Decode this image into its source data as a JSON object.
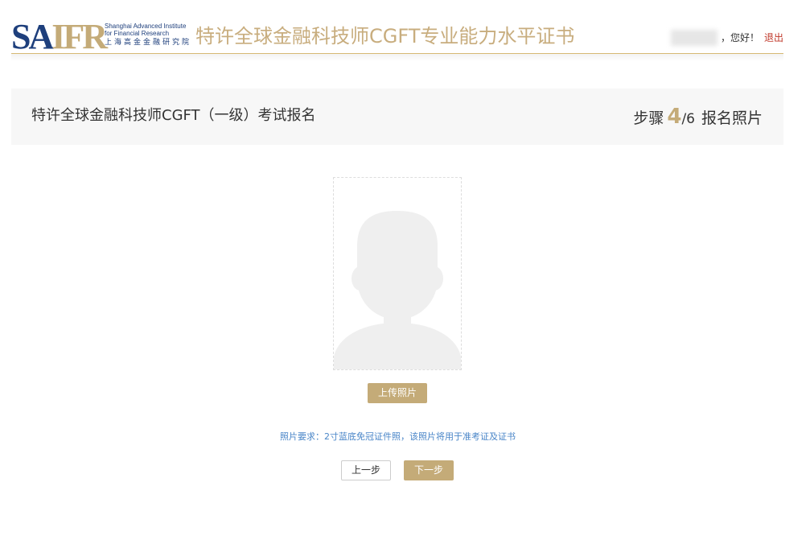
{
  "header": {
    "logo": {
      "mark": "SAIFR",
      "en_line1": "Shanghai Advanced Institute",
      "en_line2": "for Financial Research",
      "cn": "上海高金金融研究院"
    },
    "site_title": "特许全球金融科技师CGFT专业能力水平证书",
    "user": {
      "greeting": "，您好！",
      "logout_label": "退出"
    }
  },
  "title_bar": {
    "exam_title": "特许全球金融科技师CGFT（一级）考试报名",
    "step_prefix": "步骤",
    "step_current": "4",
    "step_total": "/6",
    "step_name": "报名照片"
  },
  "photo": {
    "placeholder_icon": "person-silhouette-icon",
    "upload_label": "上传照片",
    "requirement_text": "照片要求：2寸蓝底免冠证件照，该照片将用于准考证及证书"
  },
  "nav": {
    "prev_label": "上一步",
    "next_label": "下一步"
  },
  "colors": {
    "gold": "#c4ab78",
    "navy": "#1e3f7c",
    "link_blue": "#4a86c8",
    "logout_red": "#c0392b"
  }
}
